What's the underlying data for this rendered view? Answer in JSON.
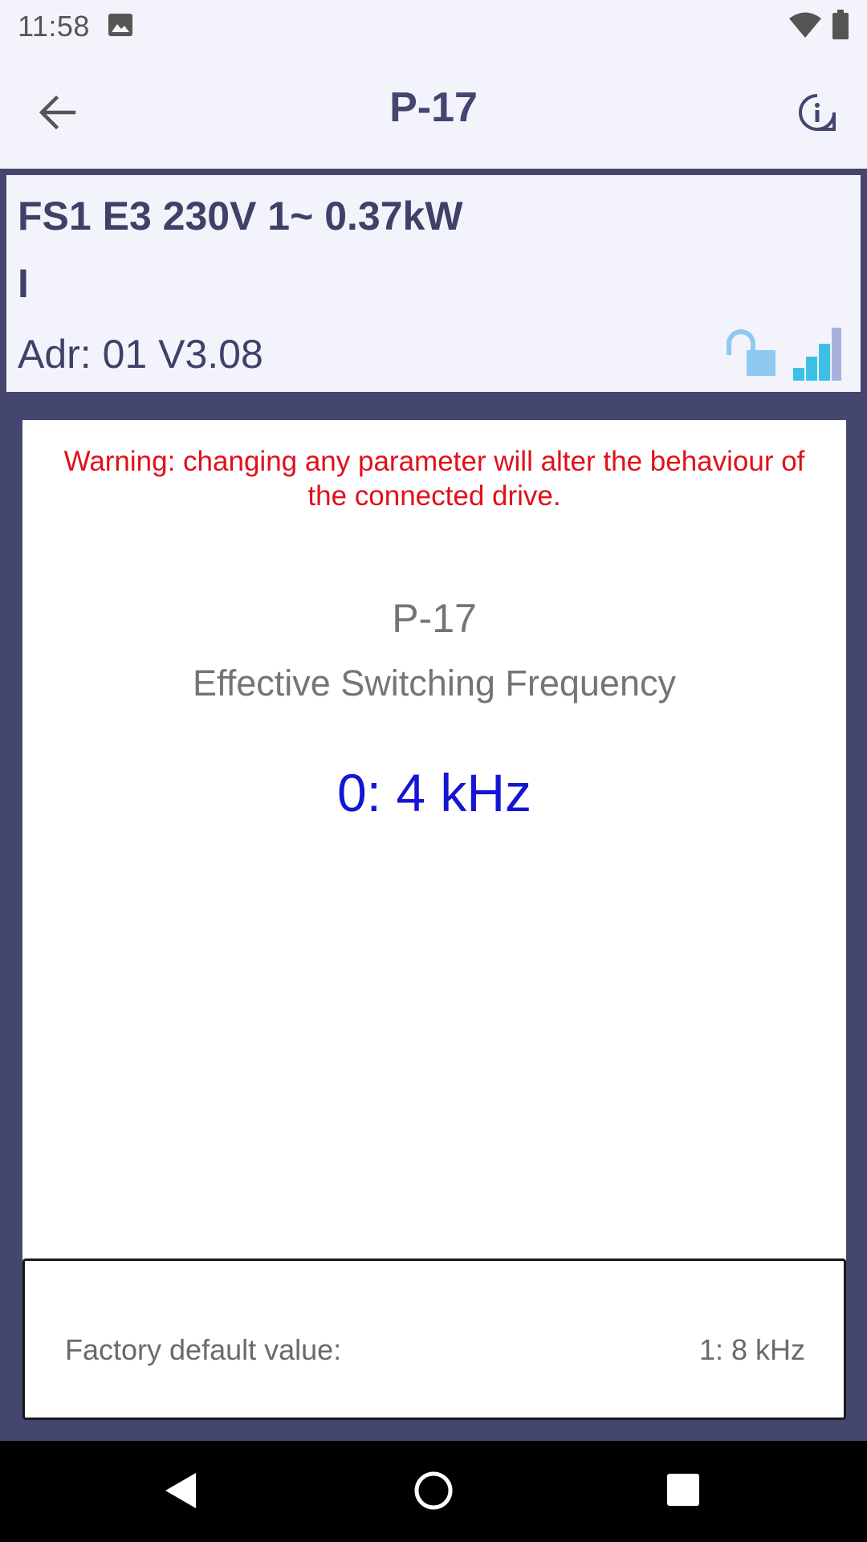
{
  "status_bar": {
    "time": "11:58",
    "icons": [
      "image-icon",
      "wifi-icon",
      "battery-icon"
    ]
  },
  "app_bar": {
    "title": "P-17",
    "back_icon": "arrow-back-icon",
    "info_icon": "info-icon"
  },
  "drive": {
    "model": "FS1 E3 230V 1~ 0.37kW",
    "status": "I",
    "address": "Adr: 01 V3.08",
    "lock_icon": "unlocked-padlock-icon",
    "signal_icon": "signal-bars-icon"
  },
  "parameter": {
    "warning": "Warning: changing any parameter will alter the behaviour of the connected drive.",
    "code": "P-17",
    "name": "Effective Switching Frequency",
    "value": "0: 4 kHz"
  },
  "factory_default": {
    "label": "Factory default value:",
    "value": "1: 8 kHz"
  },
  "nav_bar": {
    "icons": [
      "nav-back-icon",
      "nav-home-icon",
      "nav-recents-icon"
    ]
  },
  "colors": {
    "brand": "#44466f",
    "app_bar_bg": "#f3f4fb",
    "warning": "#e0101a",
    "value": "#1515d4",
    "signal_strong": "#3ec0e6",
    "signal_weak": "#a9b0e0",
    "lock": "#8fc9f2"
  }
}
